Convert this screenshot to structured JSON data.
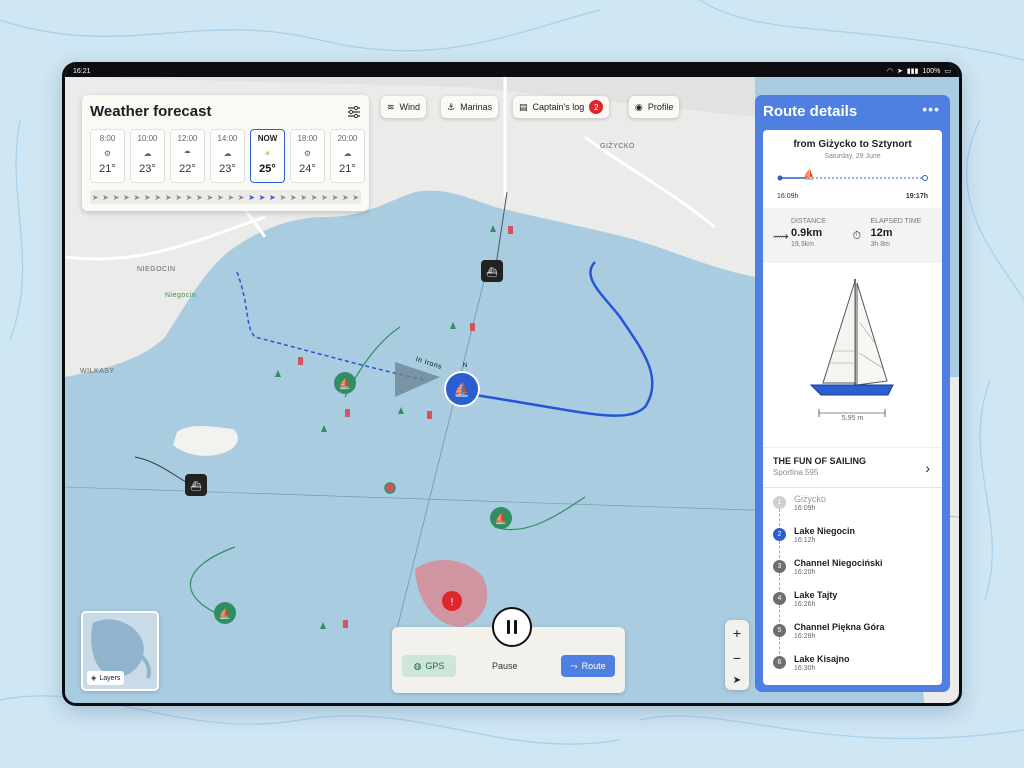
{
  "status": {
    "time": "16:21",
    "battery": "100%"
  },
  "weather": {
    "title": "Weather forecast",
    "hours": [
      {
        "time": "8:00",
        "icon": "gear-icon",
        "temp": "21°"
      },
      {
        "time": "10:00",
        "icon": "cloud-sun-icon",
        "temp": "23°"
      },
      {
        "time": "12:00",
        "icon": "rain-sun-icon",
        "temp": "22°"
      },
      {
        "time": "14:00",
        "icon": "cloud-sun-icon",
        "temp": "23°"
      },
      {
        "time": "NOW",
        "icon": "sun-icon",
        "temp": "25°"
      },
      {
        "time": "18:00",
        "icon": "gear-icon",
        "temp": "24°"
      },
      {
        "time": "20:00",
        "icon": "cloud-sun-icon",
        "temp": "21°"
      }
    ],
    "wind_arrows": [
      "➤",
      "➤",
      "➤",
      "➤",
      "➤",
      "➤",
      "➤",
      "➤",
      "➤",
      "➤",
      "➤",
      "➤",
      "➤",
      "➤",
      "➤",
      "➤",
      "➤",
      "➤",
      "➤",
      "➤",
      "➤",
      "➤",
      "➤",
      "➤",
      "➤",
      "➤",
      "➤",
      "➤",
      "➤",
      "➤"
    ]
  },
  "toolbar": {
    "wind": "Wind",
    "marinas": "Marinas",
    "captains_log": "Captain's log",
    "captains_log_count": "2",
    "profile": "Profile"
  },
  "map": {
    "labels": {
      "niegocin": "NIEGOCIN",
      "wilkasy": "WILKASY",
      "gizycko": "GIŻYCKO",
      "niegocin_small": "Niegocin",
      "in_irons": "In Irons",
      "north": "N"
    }
  },
  "route": {
    "title": "Route details",
    "from_to": "from Giżycko to Sztynort",
    "date": "Saturday, 29 June",
    "start_time": "16:09h",
    "end_time": "19:17h",
    "distance_label": "DISTANCE",
    "distance": "0.9km",
    "distance_total": "19,3km",
    "elapsed_label": "ELAPSED TIME",
    "elapsed": "12m",
    "elapsed_total": "3h 8m",
    "boat_length": "5,95 m",
    "boat_name": "THE FUN OF SAILING",
    "boat_model": "Sportina 595",
    "stops": [
      {
        "n": "1",
        "name": "Giżycko",
        "time": "16:09h",
        "state": "past"
      },
      {
        "n": "2",
        "name": "Lake Niegocin",
        "time": "16:12h",
        "state": "cur"
      },
      {
        "n": "3",
        "name": "Channel Niegociński",
        "time": "16:20h",
        "state": "next"
      },
      {
        "n": "4",
        "name": "Lake Tajty",
        "time": "16:26h",
        "state": "next"
      },
      {
        "n": "5",
        "name": "Channel Piękna Góra",
        "time": "16:28h",
        "state": "next"
      },
      {
        "n": "6",
        "name": "Lake Kisajno",
        "time": "16:30h",
        "state": "next"
      }
    ]
  },
  "controls": {
    "gps": "GPS",
    "pause": "Pause",
    "route": "Route",
    "zoom_in": "+",
    "zoom_out": "−",
    "layers": "Layers"
  },
  "colors": {
    "accent": "#4f7fe0",
    "water": "#a9cce0",
    "land": "#ebebeb",
    "green": "#2f8f63",
    "danger": "#e0262c"
  }
}
